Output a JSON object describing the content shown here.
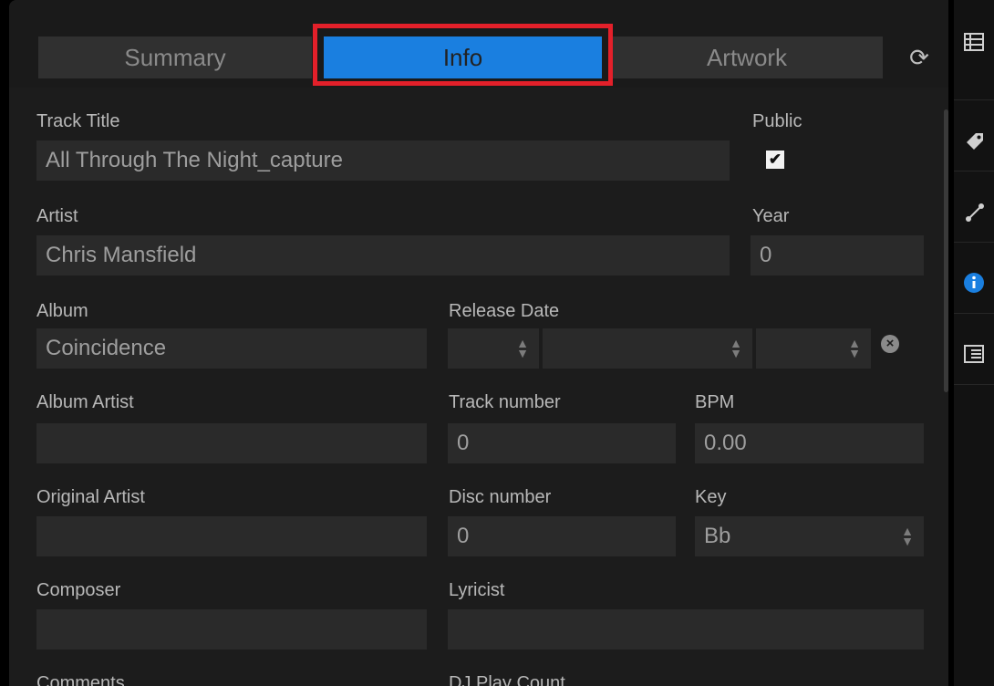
{
  "tabs": {
    "summary": "Summary",
    "info": "Info",
    "artwork": "Artwork"
  },
  "icons": {
    "sync": "sync-icon",
    "list": "list-icon",
    "tag": "tag-icon",
    "share": "share-icon",
    "info": "info-icon",
    "details": "details-icon"
  },
  "colors": {
    "active_tab": "#1a7fe0",
    "highlight_border": "#e3202a",
    "info_icon": "#1a7fe0"
  },
  "form": {
    "track_title": {
      "label": "Track Title",
      "value": "All Through The Night_capture"
    },
    "public": {
      "label": "Public",
      "checked": true,
      "mark": "✔"
    },
    "artist": {
      "label": "Artist",
      "value": "Chris Mansfield"
    },
    "year": {
      "label": "Year",
      "value": "0"
    },
    "album": {
      "label": "Album",
      "value": "Coincidence"
    },
    "release_date": {
      "label": "Release Date",
      "day": "",
      "month": "",
      "year": ""
    },
    "album_artist": {
      "label": "Album Artist",
      "value": ""
    },
    "track_number": {
      "label": "Track number",
      "value": "0"
    },
    "bpm": {
      "label": "BPM",
      "value": "0.00"
    },
    "original_artist": {
      "label": "Original Artist",
      "value": ""
    },
    "disc_number": {
      "label": "Disc number",
      "value": "0"
    },
    "key": {
      "label": "Key",
      "value": "Bb"
    },
    "composer": {
      "label": "Composer",
      "value": ""
    },
    "lyricist": {
      "label": "Lyricist",
      "value": ""
    },
    "comments": {
      "label": "Comments"
    },
    "dj_play_count": {
      "label": "DJ Play Count"
    }
  }
}
